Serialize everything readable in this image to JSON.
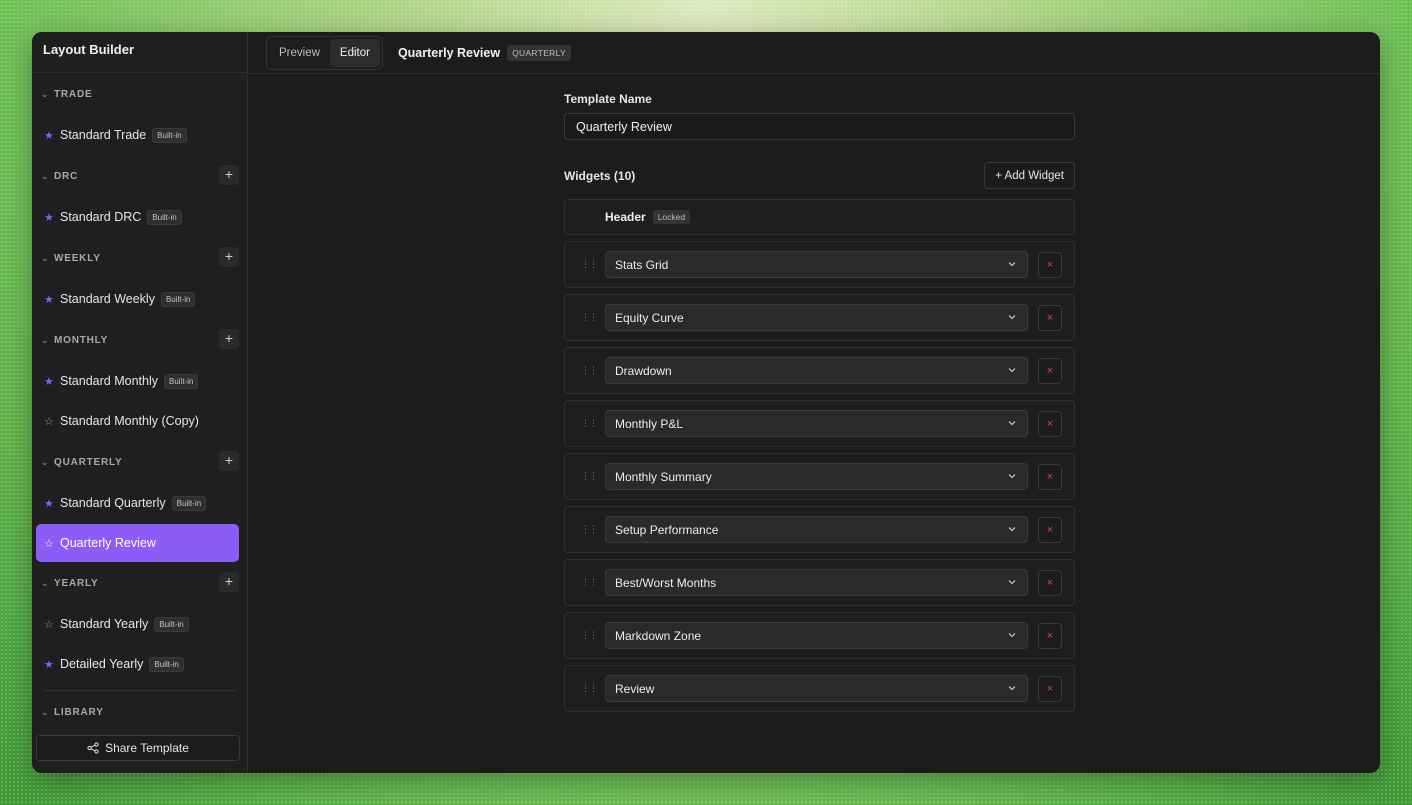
{
  "sidebar": {
    "title": "Layout Builder",
    "sections": [
      {
        "label": "TRADE",
        "has_add": false,
        "items": [
          {
            "label": "Standard Trade",
            "badge": "Built-in",
            "star": "filled",
            "active": false
          }
        ]
      },
      {
        "label": "DRC",
        "has_add": true,
        "items": [
          {
            "label": "Standard DRC",
            "badge": "Built-in",
            "star": "filled",
            "active": false
          }
        ]
      },
      {
        "label": "WEEKLY",
        "has_add": true,
        "items": [
          {
            "label": "Standard Weekly",
            "badge": "Built-in",
            "star": "filled",
            "active": false
          }
        ]
      },
      {
        "label": "MONTHLY",
        "has_add": true,
        "items": [
          {
            "label": "Standard Monthly",
            "badge": "Built-in",
            "star": "filled",
            "active": false
          },
          {
            "label": "Standard Monthly (Copy)",
            "badge": "",
            "star": "empty",
            "active": false
          }
        ]
      },
      {
        "label": "QUARTERLY",
        "has_add": true,
        "items": [
          {
            "label": "Standard Quarterly",
            "badge": "Built-in",
            "star": "filled",
            "active": false
          },
          {
            "label": "Quarterly Review",
            "badge": "",
            "star": "empty",
            "active": true
          }
        ]
      },
      {
        "label": "YEARLY",
        "has_add": true,
        "items": [
          {
            "label": "Standard Yearly",
            "badge": "Built-in",
            "star": "empty",
            "active": false
          },
          {
            "label": "Detailed Yearly",
            "badge": "Built-in",
            "star": "filled",
            "active": false
          }
        ]
      }
    ],
    "library_label": "LIBRARY",
    "share_label": "Share Template"
  },
  "topbar": {
    "tabs": [
      {
        "label": "Preview",
        "active": false
      },
      {
        "label": "Editor",
        "active": true
      }
    ],
    "title": "Quarterly Review",
    "badge": "QUARTERLY"
  },
  "editor": {
    "name_label": "Template Name",
    "name_value": "Quarterly Review",
    "widgets_label": "Widgets (10)",
    "add_widget_label": "+ Add Widget",
    "header_widget": {
      "label": "Header",
      "badge": "Locked"
    },
    "widgets": [
      "Stats Grid",
      "Equity Curve",
      "Drawdown",
      "Monthly P&L",
      "Monthly Summary",
      "Setup Performance",
      "Best/Worst Months",
      "Markdown Zone",
      "Review"
    ],
    "delete_symbol": "×"
  },
  "colors": {
    "accent": "#8b5cf6",
    "danger": "#e0404a",
    "background": "#1c1c1c"
  }
}
